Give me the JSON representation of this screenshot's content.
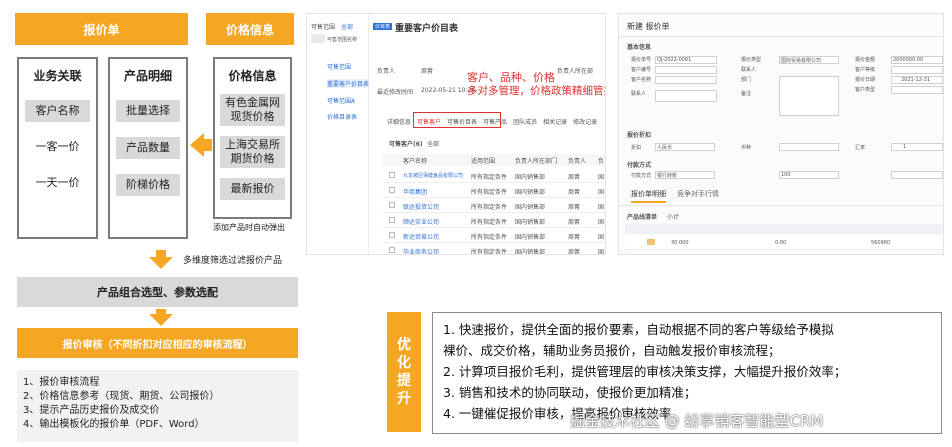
{
  "left": {
    "header_quote": "报价单",
    "header_price_info": "价格信息",
    "col1": {
      "title": "业务关联",
      "items": [
        "客户名称",
        "一客一价",
        "一天一价"
      ]
    },
    "col2": {
      "title": "产品明细",
      "items": [
        "批量选择",
        "产品数量",
        "阶梯价格"
      ]
    },
    "col3": {
      "title": "价格信息",
      "items": [
        "有色金属网\n现货价格",
        "上海交易所\n期货价格",
        "最新报价"
      ]
    },
    "col3_note": "添加产品时自动弹出",
    "filter_text": "多维度筛选过滤报价产品",
    "band_select": "产品组合选型、参数选配",
    "approval": "报价审核（不同折扣对应相应的审核流程）",
    "list": [
      "1、报价审核流程",
      "2、价格信息参考（现货、期货、公司报价）",
      "3、提示产品历史报价及成交价",
      "4、输出模板化的报价单（PDF、Word）"
    ]
  },
  "middle": {
    "tab1": "可售范围",
    "tab2": "全部",
    "left_menu": [
      "可售范围",
      "可售范围名称",
      "重要客户价目表",
      "可售范围A",
      "价格目录表"
    ],
    "tag": "价目表",
    "title": "重要客户价目表",
    "owner_label": "负责人",
    "owner_value": "周菁",
    "dept_label": "负责人所在部",
    "time_label": "最近修改时间",
    "time_value": "2022-05-21 10:28",
    "overlay_line1": "客户、品种、价格",
    "overlay_line2": "多对多管理，价格政策精细管控",
    "subtabs": [
      "详细信息",
      "可售客户",
      "可售价目表",
      "可售产品",
      "团队成员",
      "相关记录",
      "修改记录"
    ],
    "table_title": "可售客户(6)",
    "table_filter": "全部",
    "columns": [
      "客户名称",
      "适用范围",
      "负责人所在部门",
      "负责人",
      "负"
    ],
    "rows": [
      [
        "九龙坡区保健食品有限公司",
        "所有指定条件",
        "国内销售部",
        "周菁",
        "国"
      ],
      [
        "华商集团",
        "所有指定条件",
        "国内销售部",
        "周菁",
        "国"
      ],
      [
        "联达投资公司",
        "所有指定条件",
        "国内销售部",
        "周菁",
        "国"
      ],
      [
        "顺达实业公司",
        "所有指定条件",
        "国内销售部",
        "周菁",
        "国"
      ],
      [
        "新达贸易公司",
        "所有指定条件",
        "国内销售部",
        "周菁",
        "国"
      ],
      [
        "华业商务公司",
        "所有指定条件",
        "国内销售部",
        "周菁",
        "国"
      ]
    ]
  },
  "right": {
    "title": "新建 报价单",
    "section_basic": "基本信息",
    "section_discount": "报价折扣",
    "section_pay": "付款方式",
    "tab_detail": "报价单明细",
    "tab_compete": "竞争对手行情",
    "product_section": "产品线清单",
    "subtotal_label": "小计",
    "fields_left": [
      "报价单号",
      "客户编号",
      "客户名称",
      "联系人"
    ],
    "fields_mid": [
      "报价类型",
      "联系人",
      "部门",
      "备注"
    ],
    "fields_right": [
      "报价金额",
      "客户等级",
      "报价日期",
      "客户类型"
    ],
    "values": {
      "quote_no": "QJ-2022-0001",
      "customer": "国际贸易有限公司",
      "amount": "2000000.00",
      "date": "2021-12-31",
      "currency": "人民币",
      "row_qty": "30.000",
      "row_price": "0.00",
      "row_total": "560960"
    },
    "pay_label": "付款方式",
    "pay_value": "银行转账",
    "currency_label": "币种",
    "rate_label": "汇率",
    "rate_value": "1",
    "discount_label": "折扣",
    "discount_value": "100"
  },
  "optimize": {
    "tag": "优\n化\n提\n升",
    "lines": [
      "1. 快速报价，提供全面的报价要素，自动根据不同的客户等级给予模拟",
      "裸价、成交价格，辅助业务员报价，自动触发报价审核流程；",
      "2. 计算项目报价毛利，提供管理层的审核决策支撑，大幅提升报价效率；",
      "3. 销售和技术的协同联动，使报价更加精准；",
      "4. 一键催促报价审核，提高报价审核效率"
    ],
    "watermark": "掘金技术社区 @ 纷享销客智能型CRM"
  }
}
